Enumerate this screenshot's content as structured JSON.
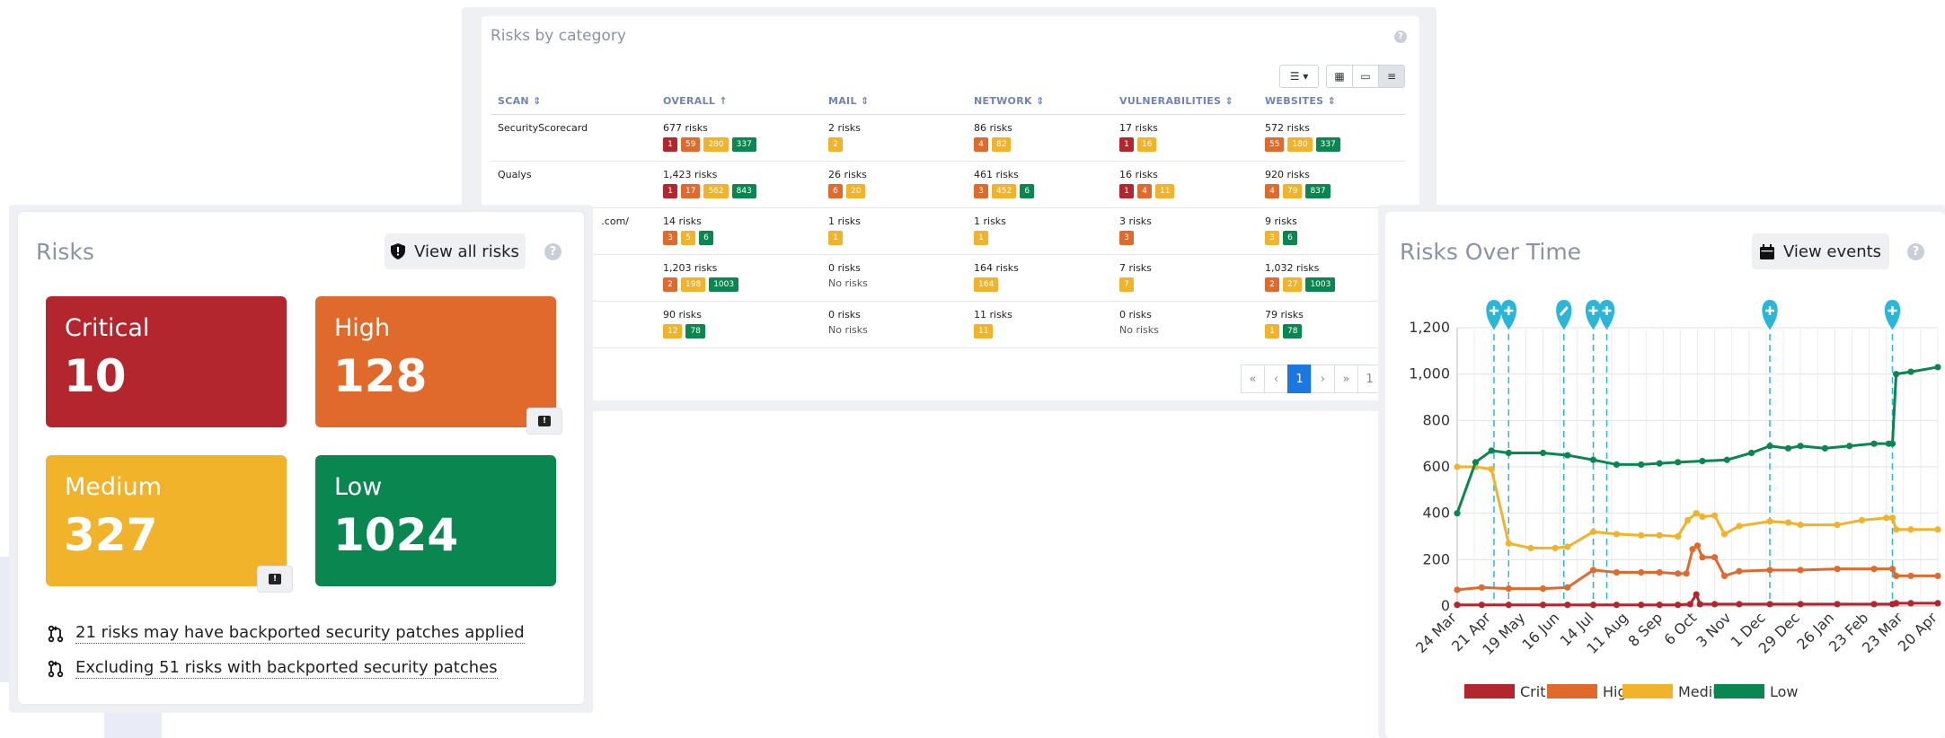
{
  "category_panel": {
    "title": "Risks by category",
    "help": "?",
    "toolbar": {
      "filter_icon": "sliders-icon",
      "views": [
        "grid-view-icon",
        "card-view-icon",
        "list-view-icon"
      ]
    },
    "columns": [
      "SCAN",
      "OVERALL",
      "MAIL",
      "NETWORK",
      "VULNERABILITIES",
      "WEBSITES"
    ],
    "rows": [
      {
        "scan": "SecurityScorecard",
        "cells": [
          {
            "text": "677 risks",
            "pills": [
              [
                "c",
                "1"
              ],
              [
                "h",
                "59"
              ],
              [
                "m",
                "280"
              ],
              [
                "l",
                "337"
              ]
            ]
          },
          {
            "text": "2 risks",
            "pills": [
              [
                "m",
                "2"
              ]
            ]
          },
          {
            "text": "86 risks",
            "pills": [
              [
                "h",
                "4"
              ],
              [
                "m",
                "82"
              ]
            ]
          },
          {
            "text": "17 risks",
            "pills": [
              [
                "c",
                "1"
              ],
              [
                "m",
                "16"
              ]
            ]
          },
          {
            "text": "572 risks",
            "pills": [
              [
                "h",
                "55"
              ],
              [
                "m",
                "180"
              ],
              [
                "l",
                "337"
              ]
            ]
          }
        ]
      },
      {
        "scan": "Qualys",
        "cells": [
          {
            "text": "1,423 risks",
            "pills": [
              [
                "c",
                "1"
              ],
              [
                "h",
                "17"
              ],
              [
                "m",
                "562"
              ],
              [
                "l",
                "843"
              ]
            ]
          },
          {
            "text": "26 risks",
            "pills": [
              [
                "h",
                "6"
              ],
              [
                "m",
                "20"
              ]
            ]
          },
          {
            "text": "461 risks",
            "pills": [
              [
                "h",
                "3"
              ],
              [
                "m",
                "452"
              ],
              [
                "l",
                "6"
              ]
            ]
          },
          {
            "text": "16 risks",
            "pills": [
              [
                "c",
                "1"
              ],
              [
                "h",
                "4"
              ],
              [
                "m",
                "11"
              ]
            ]
          },
          {
            "text": "920 risks",
            "pills": [
              [
                "h",
                "4"
              ],
              [
                "m",
                "79"
              ],
              [
                "l",
                "837"
              ]
            ]
          }
        ]
      },
      {
        "scan": ".com/",
        "cells": [
          {
            "text": "14 risks",
            "pills": [
              [
                "h",
                "3"
              ],
              [
                "m",
                "5"
              ],
              [
                "l",
                "6"
              ]
            ]
          },
          {
            "text": "1 risks",
            "pills": [
              [
                "m",
                "1"
              ]
            ]
          },
          {
            "text": "1 risks",
            "pills": [
              [
                "m",
                "1"
              ]
            ]
          },
          {
            "text": "3 risks",
            "pills": [
              [
                "h",
                "3"
              ]
            ]
          },
          {
            "text": "9 risks",
            "pills": [
              [
                "m",
                "3"
              ],
              [
                "l",
                "6"
              ]
            ]
          }
        ]
      },
      {
        "scan": "",
        "cells": [
          {
            "text": "1,203 risks",
            "pills": [
              [
                "h",
                "2"
              ],
              [
                "m",
                "198"
              ],
              [
                "l",
                "1003"
              ]
            ]
          },
          {
            "text": "0 risks",
            "norisk": "No risks"
          },
          {
            "text": "164 risks",
            "pills": [
              [
                "m",
                "164"
              ]
            ]
          },
          {
            "text": "7 risks",
            "pills": [
              [
                "m",
                "7"
              ]
            ]
          },
          {
            "text": "1,032 risks",
            "pills": [
              [
                "h",
                "2"
              ],
              [
                "m",
                "27"
              ],
              [
                "l",
                "1003"
              ]
            ]
          }
        ]
      },
      {
        "scan": "",
        "cells": [
          {
            "text": "90 risks",
            "pills": [
              [
                "m",
                "12"
              ],
              [
                "l",
                "78"
              ]
            ]
          },
          {
            "text": "0 risks",
            "norisk": "No risks"
          },
          {
            "text": "11 risks",
            "pills": [
              [
                "m",
                "11"
              ]
            ]
          },
          {
            "text": "0 risks",
            "norisk": "No risks"
          },
          {
            "text": "79 risks",
            "pills": [
              [
                "m",
                "1"
              ],
              [
                "l",
                "78"
              ]
            ]
          }
        ]
      }
    ],
    "pager": [
      "«",
      "‹",
      "1",
      "›",
      "»",
      "1"
    ],
    "pager_active": "1"
  },
  "risks_card": {
    "title": "Risks",
    "view_all_label": "View all risks",
    "view_all_icon": "shield-icon",
    "help": "?",
    "severities": {
      "critical": {
        "label": "Critical",
        "count": "10",
        "color": "#b3262d"
      },
      "high": {
        "label": "High",
        "count": "128",
        "color": "#e06a2c"
      },
      "medium": {
        "label": "Medium",
        "count": "327",
        "color": "#f0b32a"
      },
      "low": {
        "label": "Low",
        "count": "1024",
        "color": "#0a8650"
      }
    },
    "notes": [
      "21 risks may have backported security patches applied",
      "Excluding 51 risks with backported security patches"
    ]
  },
  "risks_over_time": {
    "title": "Risks Over Time",
    "view_events_label": "View events",
    "view_events_icon": "calendar-icon",
    "help": "?"
  },
  "chart_data": {
    "type": "line",
    "ylim": [
      0,
      1200
    ],
    "yticks": [
      "0",
      "200",
      "400",
      "600",
      "800",
      "1,000",
      "1,200"
    ],
    "x_labels": [
      "24 Mar",
      "21 Apr",
      "19 May",
      "16 Jun",
      "14 Jul",
      "11 Aug",
      "8 Sep",
      "6 Oct",
      "3 Nov",
      "1 Dec",
      "29 Dec",
      "26 Jan",
      "23 Feb",
      "23 Mar",
      "20 Apr"
    ],
    "x_range_days": [
      0,
      392
    ],
    "event_markers": [
      {
        "day": 30,
        "icon": "plus"
      },
      {
        "day": 42,
        "icon": "plus"
      },
      {
        "day": 87,
        "icon": "edit"
      },
      {
        "day": 111,
        "icon": "plus"
      },
      {
        "day": 122,
        "icon": "plus"
      },
      {
        "day": 255,
        "icon": "plus"
      },
      {
        "day": 355,
        "icon": "plus"
      }
    ],
    "series": [
      {
        "name": "Critical",
        "color": "#b3262d",
        "points": [
          [
            0,
            5
          ],
          [
            20,
            5
          ],
          [
            42,
            5
          ],
          [
            70,
            5
          ],
          [
            90,
            5
          ],
          [
            111,
            5
          ],
          [
            130,
            5
          ],
          [
            150,
            5
          ],
          [
            165,
            5
          ],
          [
            180,
            5
          ],
          [
            190,
            8
          ],
          [
            195,
            50
          ],
          [
            198,
            8
          ],
          [
            210,
            8
          ],
          [
            230,
            8
          ],
          [
            255,
            8
          ],
          [
            280,
            8
          ],
          [
            310,
            8
          ],
          [
            340,
            8
          ],
          [
            355,
            8
          ],
          [
            358,
            12
          ],
          [
            370,
            12
          ],
          [
            392,
            12
          ]
        ]
      },
      {
        "name": "High",
        "color": "#e06a2c",
        "points": [
          [
            0,
            70
          ],
          [
            20,
            80
          ],
          [
            42,
            75
          ],
          [
            70,
            75
          ],
          [
            90,
            80
          ],
          [
            111,
            155
          ],
          [
            130,
            145
          ],
          [
            150,
            145
          ],
          [
            165,
            145
          ],
          [
            180,
            140
          ],
          [
            187,
            140
          ],
          [
            192,
            245
          ],
          [
            196,
            260
          ],
          [
            200,
            210
          ],
          [
            210,
            210
          ],
          [
            218,
            130
          ],
          [
            230,
            150
          ],
          [
            255,
            155
          ],
          [
            280,
            155
          ],
          [
            310,
            160
          ],
          [
            340,
            160
          ],
          [
            355,
            160
          ],
          [
            358,
            130
          ],
          [
            370,
            130
          ],
          [
            392,
            130
          ]
        ]
      },
      {
        "name": "Medium",
        "color": "#f0b32a",
        "points": [
          [
            0,
            600
          ],
          [
            15,
            600
          ],
          [
            28,
            590
          ],
          [
            42,
            270
          ],
          [
            60,
            250
          ],
          [
            80,
            250
          ],
          [
            90,
            255
          ],
          [
            111,
            320
          ],
          [
            130,
            310
          ],
          [
            150,
            305
          ],
          [
            165,
            305
          ],
          [
            180,
            300
          ],
          [
            188,
            370
          ],
          [
            195,
            400
          ],
          [
            200,
            385
          ],
          [
            210,
            390
          ],
          [
            218,
            310
          ],
          [
            230,
            345
          ],
          [
            255,
            365
          ],
          [
            270,
            360
          ],
          [
            280,
            350
          ],
          [
            310,
            350
          ],
          [
            330,
            370
          ],
          [
            350,
            380
          ],
          [
            355,
            380
          ],
          [
            358,
            330
          ],
          [
            370,
            330
          ],
          [
            392,
            330
          ]
        ]
      },
      {
        "name": "Low",
        "color": "#0a8650",
        "points": [
          [
            0,
            400
          ],
          [
            15,
            620
          ],
          [
            28,
            670
          ],
          [
            42,
            660
          ],
          [
            70,
            660
          ],
          [
            90,
            650
          ],
          [
            111,
            630
          ],
          [
            130,
            610
          ],
          [
            150,
            610
          ],
          [
            165,
            615
          ],
          [
            180,
            620
          ],
          [
            200,
            625
          ],
          [
            220,
            630
          ],
          [
            240,
            660
          ],
          [
            255,
            690
          ],
          [
            270,
            680
          ],
          [
            280,
            690
          ],
          [
            300,
            680
          ],
          [
            320,
            690
          ],
          [
            340,
            700
          ],
          [
            352,
            700
          ],
          [
            355,
            700
          ],
          [
            358,
            1000
          ],
          [
            370,
            1010
          ],
          [
            392,
            1030
          ]
        ]
      }
    ]
  }
}
